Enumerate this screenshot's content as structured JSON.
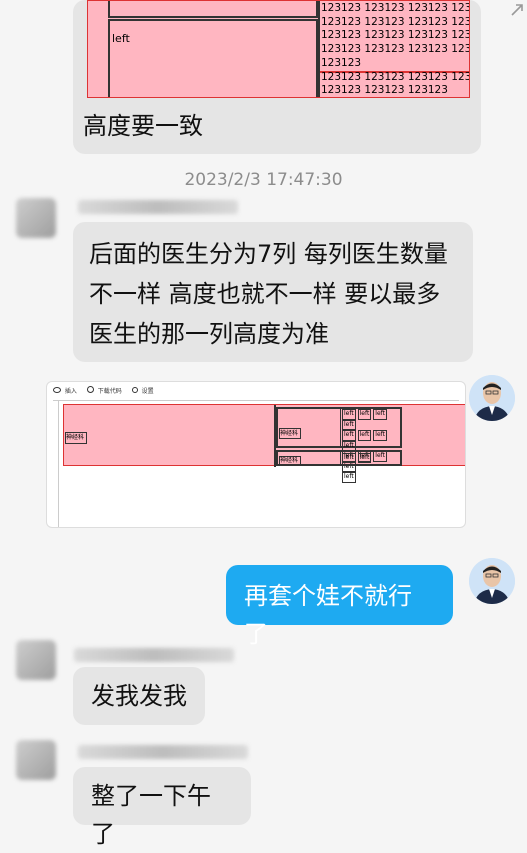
{
  "colors": {
    "pink": "#ffb6c1",
    "bubble_gray": "#e5e5e5",
    "bubble_blue": "#1eaaf1",
    "page_bg": "#f5f5f5"
  },
  "icons": [
    "share-icon",
    "eye-icon",
    "download-icon",
    "search-icon",
    "person-avatar"
  ],
  "messages": {
    "m1": {
      "left_label": "left",
      "num_lines": [
        "123123 123123 123123 123123 123123",
        "123123 123123 123123 123123 123123",
        "123123 123123 123123 123123 123123",
        "123123 123123 123123 123123 123123",
        "123123",
        "123123 123123 123123 123123 123123",
        "123123 123123 123123"
      ],
      "text": "高度要一致"
    },
    "timestamp": "2023/2/3 17:47:30",
    "m2": {
      "lines": [
        "后面的医生分为7列  每列医生数量",
        "不一样  高度也就不一样  要以最多",
        "医生的那一列高度为准"
      ]
    },
    "m3": {
      "toolbar": [
        "插入",
        "下载代码",
        "设置"
      ],
      "dept": "神经科",
      "cell": "left"
    },
    "m4": {
      "text": "再套个娃不就行了"
    },
    "m5": {
      "text": "发我发我"
    },
    "m6": {
      "text": "整了一下午了"
    }
  }
}
